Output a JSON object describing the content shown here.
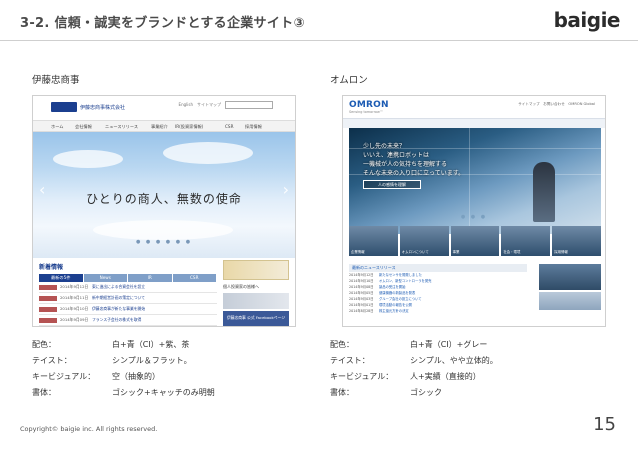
{
  "header": {
    "title": "3-2. 信頼・誠実をブランドとする企業サイト③",
    "brand": "baigie"
  },
  "left": {
    "company": "伊藤忠商事",
    "screenshot": {
      "logo_text": "伊藤忠商事株式会社",
      "util_text": "English　サイトマップ",
      "nav": [
        "ホーム",
        "会社情報",
        "ニュースリリース",
        "事業紹介",
        "IR(投資家情報)",
        "CSR",
        "採用情報"
      ],
      "hero_text": "ひとりの商人、無数の使命",
      "dots": "● ● ● ● ● ●",
      "news_title": "新着情報",
      "tabs": [
        "最新の5件",
        "News",
        "IR",
        "CSR"
      ],
      "rows": [
        {
          "date": "2014年9月12日",
          "text": "東に進出による合資会社を設立"
        },
        {
          "date": "2014年9月11日",
          "text": "新中期経営計画の策定について"
        },
        {
          "date": "2014年9月10日",
          "text": "伊藤忠商事が新たな事業を開始"
        },
        {
          "date": "2014年9月09日",
          "text": "フランス子会社の株式を取得"
        },
        {
          "date": "2014年9月05日",
          "text": "グループ会社の組織変更について"
        }
      ],
      "side_banner": "伊藤忠商事",
      "side_label": "個人投資家の皆様へ",
      "fb_text": "伊藤忠商事 公式 Facebookページ"
    },
    "attributes": [
      {
        "label": "配色：",
        "value": "白+青（CI）+紫、茶"
      },
      {
        "label": "テイスト：",
        "value": "シンプル＆フラット。"
      },
      {
        "label": "キービジュアル：",
        "value": "空（抽象的）"
      },
      {
        "label": "書体：",
        "value": "ゴシック+キャッチのみ明朝"
      }
    ]
  },
  "right": {
    "company": "オムロン",
    "screenshot": {
      "logo": "OMRON",
      "sub": "Sensing tomorrow™",
      "util_text": "サイトマップ　お問い合わせ　OMRON Global",
      "hero_lines": [
        "少し先の未来？",
        "いいえ、連携ロボットは",
        "一機械が人の気持ちを理解する",
        "そんな未来の入り口に立っています。"
      ],
      "hero_btn": "人の感情を理解",
      "dots": "● ● ●",
      "thumbs": [
        "企業情報",
        "オムロンについて",
        "事業",
        "社会・環境",
        "採用情報"
      ],
      "news_head": "最新のニュースリリース",
      "news": [
        {
          "date": "2014年9月12日",
          "text": "新たなセンサを開発しました"
        },
        {
          "date": "2014年9月10日",
          "text": "オムロン、新型コントローラを発売"
        },
        {
          "date": "2014年9月08日",
          "text": "製品の受注を開始"
        },
        {
          "date": "2014年9月05日",
          "text": "健康機器の新製品を発表"
        },
        {
          "date": "2014年9月03日",
          "text": "グループ会社の設立について"
        },
        {
          "date": "2014年9月01日",
          "text": "環境活動の報告を公開"
        },
        {
          "date": "2014年8月28日",
          "text": "株主還元方針の決定"
        }
      ]
    },
    "attributes": [
      {
        "label": "配色：",
        "value": "白+青（CI）+グレー"
      },
      {
        "label": "テイスト：",
        "value": "シンプル、やや立体的。"
      },
      {
        "label": "キービジュアル：",
        "value": "人+実績（直接的）"
      },
      {
        "label": "書体：",
        "value": "ゴシック"
      }
    ]
  },
  "footer": {
    "copyright": "Copyright© baigie inc. All rights reserved.",
    "page": "15"
  },
  "colors": {
    "itochu_blue": "#1b3f8f",
    "omron_blue": "#1c5bb3"
  }
}
